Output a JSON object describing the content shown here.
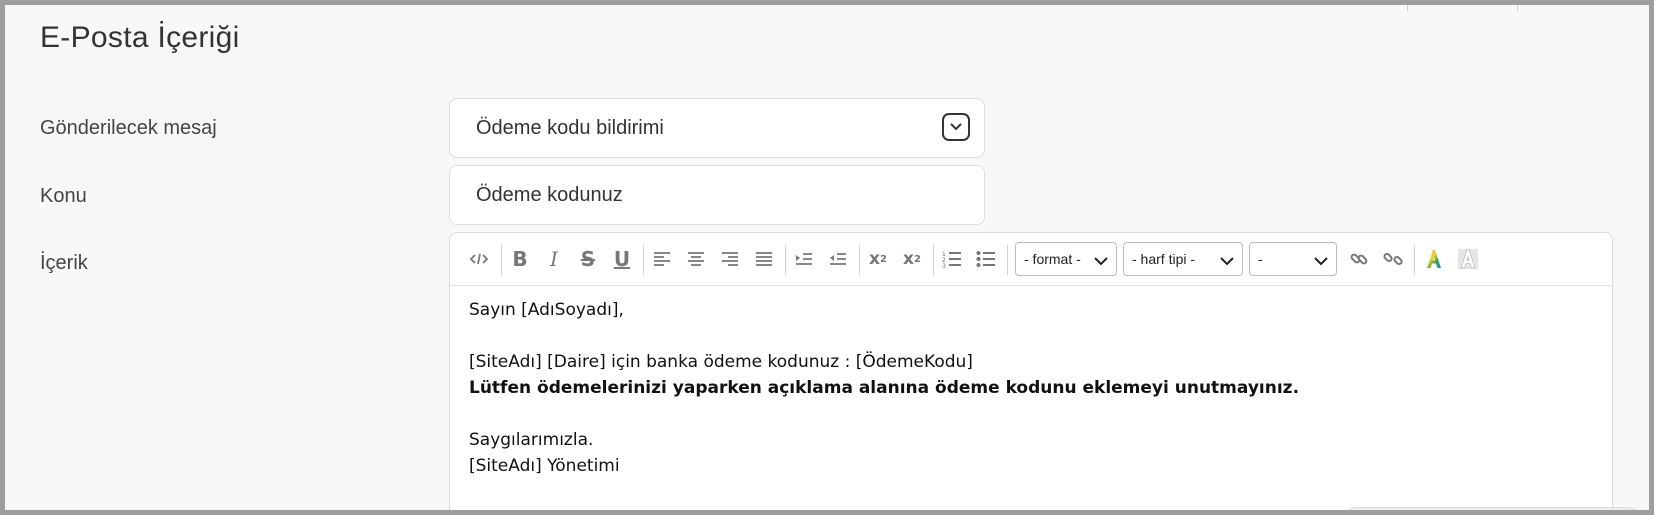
{
  "section": {
    "title": "E-Posta İçeriği"
  },
  "form": {
    "message_label": "Gönderilecek mesaj",
    "message_value": "Ödeme kodu bildirimi",
    "subject_label": "Konu",
    "subject_value": "Ödeme kodunuz",
    "content_label": "İçerik"
  },
  "toolbar": {
    "format_select": "- format -",
    "font_select": "- harf tipi -",
    "size_select": "-",
    "icons": [
      "source-code",
      "bold",
      "italic",
      "strikethrough",
      "underline",
      "align-left",
      "align-center",
      "align-right",
      "align-justify",
      "outdent",
      "indent",
      "subscript",
      "superscript",
      "ordered-list",
      "unordered-list",
      "link",
      "unlink",
      "text-color",
      "highlight-color"
    ]
  },
  "editor": {
    "lines": [
      "Sayın [AdıSoyadı],",
      "",
      "[SiteAdı] [Daire] için banka ödeme kodunuz : [ÖdemeKodu]",
      "Lütfen ödemelerinizi yaparken açıklama alanına ödeme kodunu eklemeyi unutmayınız.",
      "",
      "Saygılarımızla.",
      "[SiteAdı] Yönetimi"
    ]
  },
  "colors": {
    "frame": "#9e9e9e",
    "background": "#f8f8f8",
    "border": "#dddddd"
  }
}
